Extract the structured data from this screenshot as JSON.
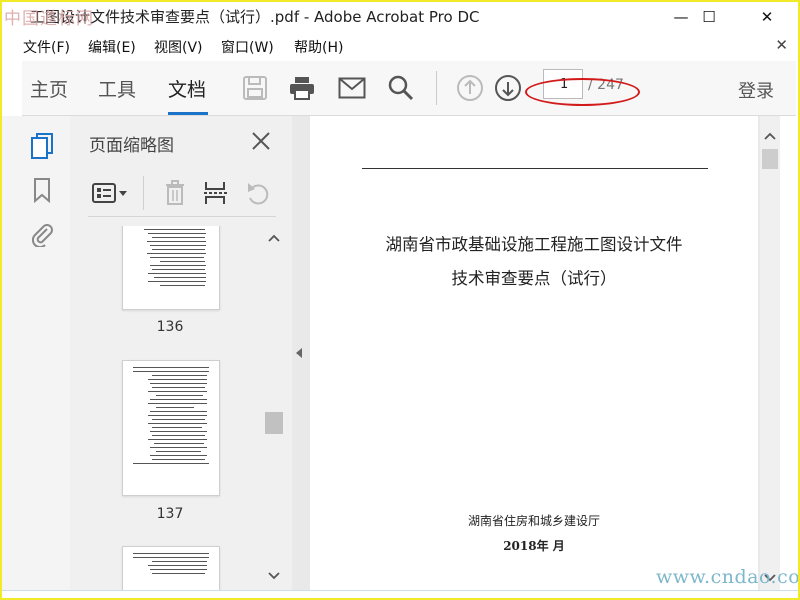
{
  "window": {
    "title": "工图设计文件技术审查要点（试行）.pdf - Adobe Acrobat Pro DC",
    "minimize": "—",
    "maximize": "☐",
    "close": "✕"
  },
  "watermarks": {
    "top_left": "中国道标网",
    "bottom_right": "www.cndao.com"
  },
  "menu": {
    "items": [
      "文件(F)",
      "编辑(E)",
      "视图(V)",
      "窗口(W)",
      "帮助(H)"
    ],
    "close_document": "✕"
  },
  "toolbar": {
    "tabs": [
      "主页",
      "工具",
      "文档"
    ],
    "active_tab": "文档",
    "icons": [
      "save-icon",
      "print-icon",
      "email-icon",
      "search-icon",
      "page-up-icon",
      "page-down-icon"
    ],
    "current_page": "1",
    "total_pages": "/ 247",
    "login": "登录",
    "annotation_color": "#d21a1a",
    "accent_color": "#1a73c9"
  },
  "rail": {
    "icons": [
      "page-thumbnails-icon",
      "bookmark-icon",
      "attachment-icon"
    ],
    "active_color": "#1a73c9"
  },
  "thumbnail_panel": {
    "title": "页面缩略图",
    "close": "✕",
    "tools": [
      "thumbnail-options-icon",
      "delete-page-icon",
      "extract-page-icon",
      "rotate-page-icon"
    ],
    "pages": [
      "136",
      "137",
      ""
    ]
  },
  "document": {
    "title_line1": "湖南省市政基础设施工程施工图设计文件",
    "title_line2": "技术审查要点（试行）",
    "issuer": "湖南省住房和城乡建设厅",
    "date": "2018年  月"
  }
}
